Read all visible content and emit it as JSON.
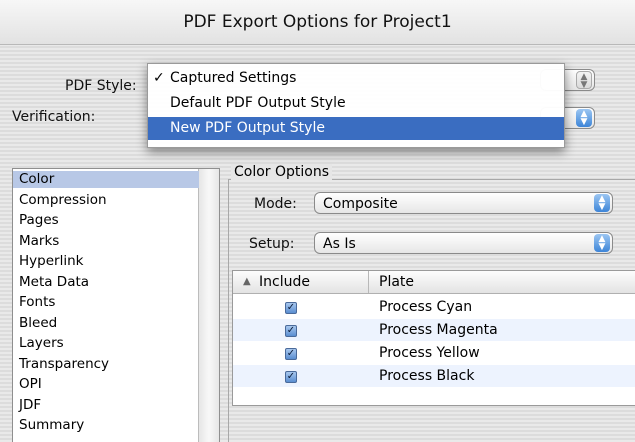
{
  "window": {
    "title": "PDF Export Options for Project1"
  },
  "form": {
    "pdf_style_label": "PDF Style:",
    "verification_label": "Verification:"
  },
  "pdf_style_menu": {
    "items": [
      {
        "label": "Captured Settings",
        "checked": true
      },
      {
        "label": "Default PDF Output Style",
        "checked": false
      },
      {
        "label": "New PDF Output Style",
        "checked": false,
        "highlighted": true
      }
    ],
    "check_glyph": "✓"
  },
  "categories": {
    "items": [
      "Color",
      "Compression",
      "Pages",
      "Marks",
      "Hyperlink",
      "Meta Data",
      "Fonts",
      "Bleed",
      "Layers",
      "Transparency",
      "OPI",
      "JDF",
      "Summary"
    ],
    "selected": "Color"
  },
  "color_options": {
    "group_title": "Color Options",
    "mode_label": "Mode:",
    "mode_value": "Composite",
    "setup_label": "Setup:",
    "setup_value": "As Is"
  },
  "plates_table": {
    "columns": [
      "Include",
      "Plate"
    ],
    "rows": [
      {
        "include": true,
        "plate": "Process Cyan"
      },
      {
        "include": true,
        "plate": "Process Magenta"
      },
      {
        "include": true,
        "plate": "Process Yellow"
      },
      {
        "include": true,
        "plate": "Process Black"
      }
    ]
  },
  "colors": {
    "highlight": "#3a6dc1",
    "list_selection": "#b8c8e6",
    "row_alt": "#edf3fe"
  }
}
